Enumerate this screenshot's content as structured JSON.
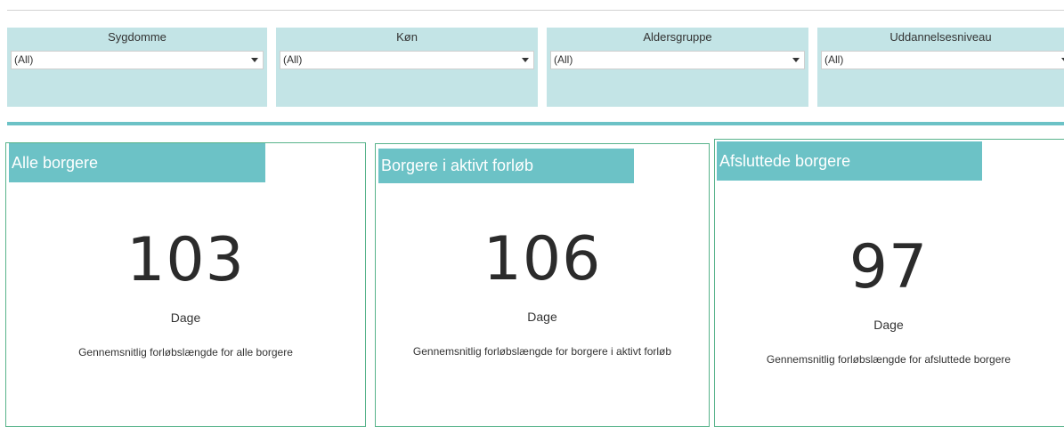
{
  "filters": [
    {
      "label": "Sygdomme",
      "value": "(All)"
    },
    {
      "label": "Køn",
      "value": "(All)"
    },
    {
      "label": "Aldersgruppe",
      "value": "(All)"
    },
    {
      "label": "Uddannelsesniveau",
      "value": "(All)"
    }
  ],
  "cards": [
    {
      "title": "Alle borgere",
      "value": "103",
      "unit": "Dage",
      "description": "Gennemsnitlig forløbslængde for alle borgere"
    },
    {
      "title": "Borgere i aktivt forløb",
      "value": "106",
      "unit": "Dage",
      "description": "Gennemsnitlig forløbslængde for  borgere i aktivt forløb"
    },
    {
      "title": "Afsluttede borgere",
      "value": "97",
      "unit": "Dage",
      "description": "Gennemsnitlig forløbslængde for afsluttede borgere"
    }
  ],
  "colors": {
    "accent": "#6cc2c6",
    "filter_bg": "#c3e4e6",
    "card_border": "#58b38b"
  }
}
